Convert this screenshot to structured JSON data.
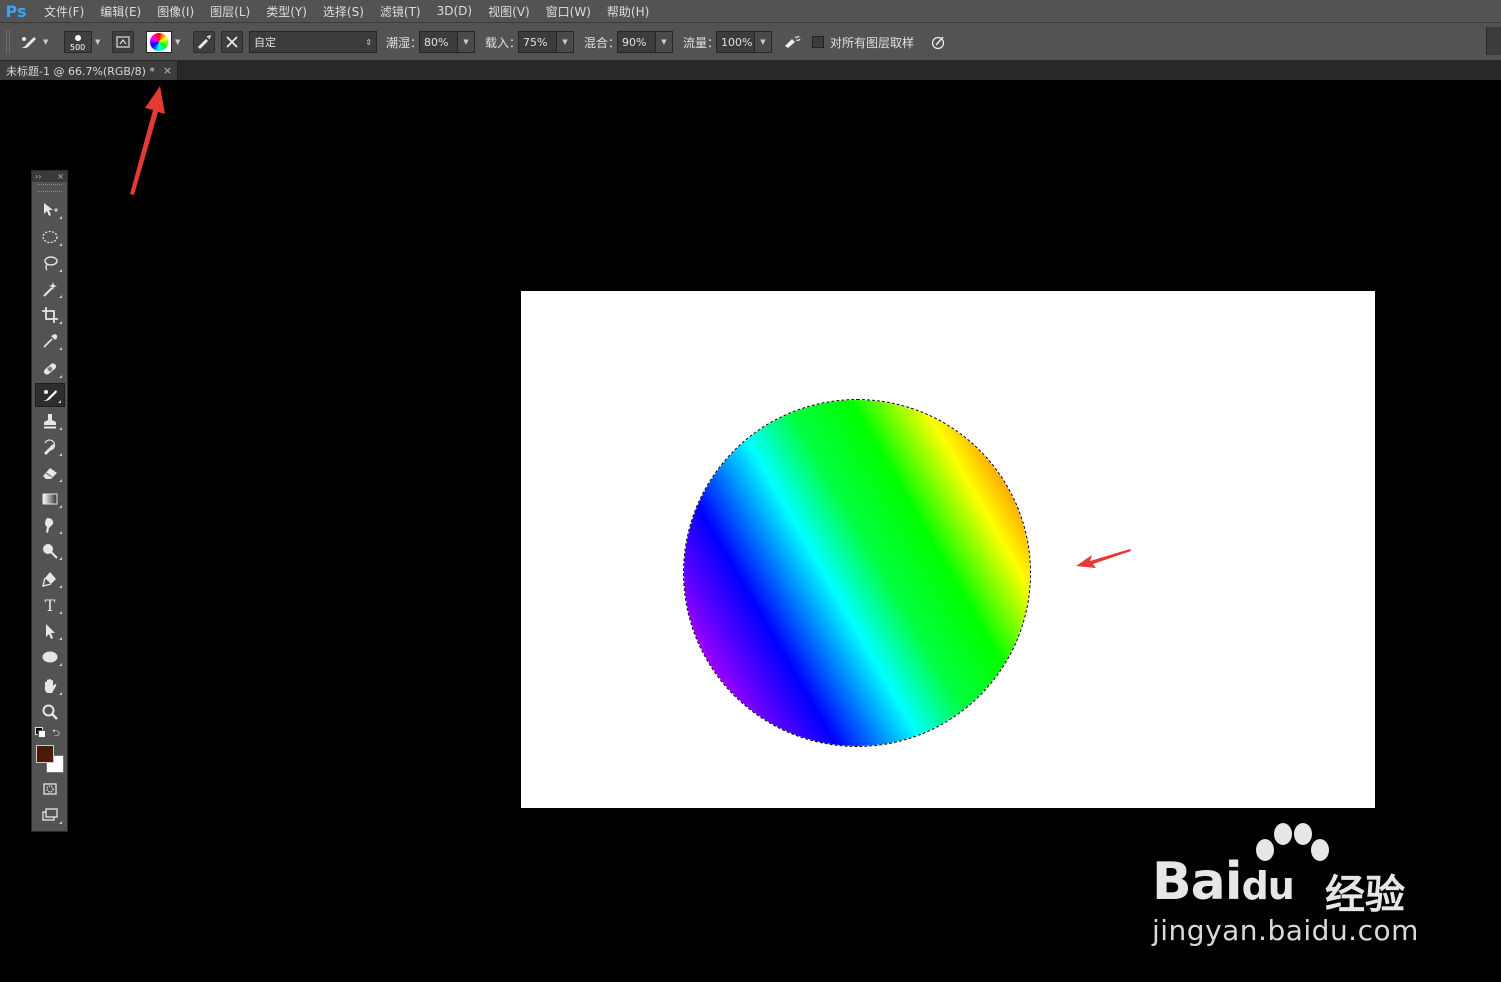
{
  "app": {
    "logo": "Ps"
  },
  "menu": [
    "文件(F)",
    "编辑(E)",
    "图像(I)",
    "图层(L)",
    "类型(Y)",
    "选择(S)",
    "滤镜(T)",
    "3D(D)",
    "视图(V)",
    "窗口(W)",
    "帮助(H)"
  ],
  "options": {
    "brush_size": "500",
    "preset": "自定",
    "wet_label": "潮湿：",
    "wet_value": "80%",
    "load_label": "载入：",
    "load_value": "75%",
    "mix_label": "混合：",
    "mix_value": "90%",
    "flow_label": "流量：",
    "flow_value": "100%",
    "sample_all_label": "对所有图层取样",
    "sample_all_checked": false
  },
  "document": {
    "tab_title": "未标题-1 @ 66.7%(RGB/8) *",
    "tab_close": "×"
  },
  "toolbar": {
    "header_expand": "››",
    "header_close": "×",
    "foreground_color": "#4a1a0a",
    "background_color": "#ffffff",
    "tools": [
      "move",
      "elliptical-marquee",
      "lasso",
      "magic-wand",
      "crop",
      "eyedropper",
      "healing-brush",
      "mixer-brush",
      "clone-stamp",
      "history-brush",
      "eraser",
      "gradient",
      "blur",
      "dodge",
      "pen",
      "type",
      "path-selection",
      "ellipse-shape",
      "hand",
      "zoom",
      "quick-mask",
      "screen-mode"
    ],
    "active_tool": "mixer-brush"
  },
  "annotations": {
    "arrow_color": "#e53935"
  },
  "watermark": {
    "brand": "Bai",
    "brand_du": "du",
    "brand_cn": "经验",
    "url": "jingyan.baidu.com"
  }
}
